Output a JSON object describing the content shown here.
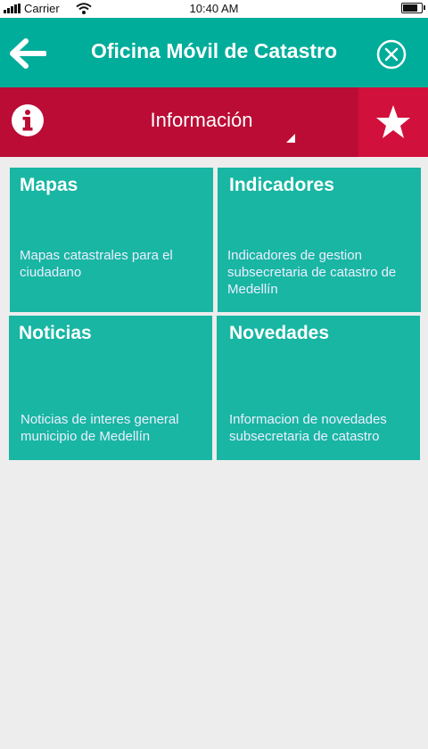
{
  "status_bar": {
    "carrier": "Carrier",
    "time": "10:40 AM",
    "battery_level": 0.9
  },
  "header": {
    "title": "Oficina Móvil de Catastro",
    "back_icon": "arrow-left-icon",
    "close_icon": "close-circle-icon"
  },
  "info_bar": {
    "label": "Información",
    "info_icon": "info-circle-icon",
    "favorite_icon": "star-icon"
  },
  "tiles": [
    {
      "title": "Mapas",
      "description": "Mapas catastrales para el ciudadano"
    },
    {
      "title": "Indicadores",
      "description": "Indicadores de gestion subsecretaria de catastro de Medellín"
    },
    {
      "title": "Noticias",
      "description": "Noticias de interes general municipio de Medellín"
    },
    {
      "title": "Novedades",
      "description": "Informacion de novedades subsecretaria de catastro"
    }
  ],
  "colors": {
    "header": "#00ad9a",
    "tile": "#18b6a3",
    "info_bar": "#bb0c35",
    "favorite": "#d2103c",
    "background": "#ededed"
  }
}
